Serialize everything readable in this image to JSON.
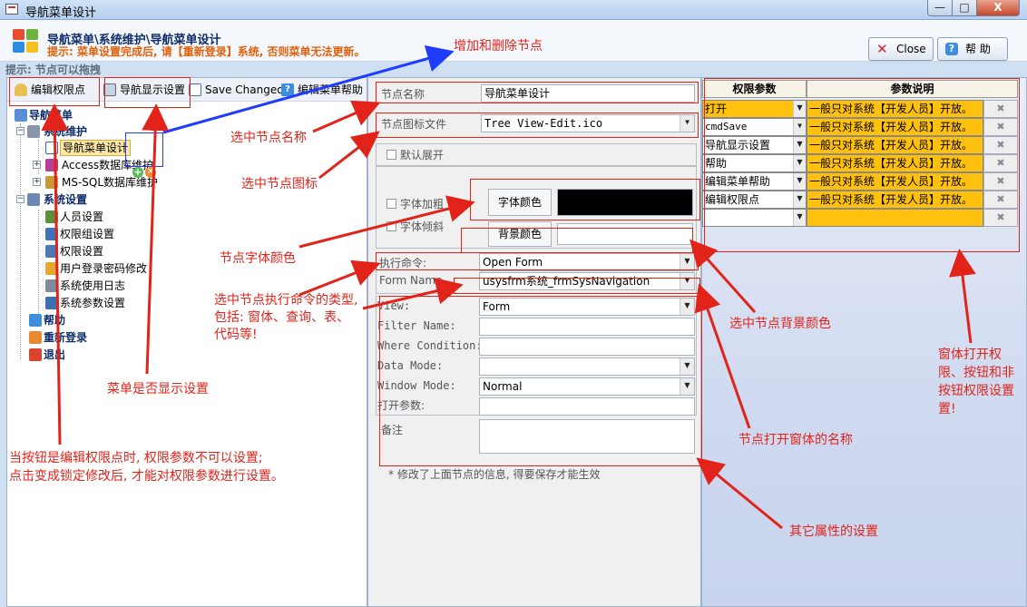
{
  "window": {
    "title": "导航菜单设计",
    "controls": [
      "—",
      "□",
      "X"
    ]
  },
  "header": {
    "breadcrumb": "导航菜单\\系统维护\\导航菜单设计",
    "hint": "提示: 菜单设置完成后, 请【重新登录】系统, 否则菜单无法更新。",
    "close_label": "Close",
    "help_label": "帮  助"
  },
  "subhint": "提示: 节点可以拖拽",
  "toolbar": {
    "edit_perm": "编辑权限点",
    "nav_display": "导航显示设置",
    "save_changed": "Save Changed",
    "edit_help": "编辑菜单帮助"
  },
  "tree": {
    "root": "导航菜单",
    "sys_maint": "系统维护",
    "nav_design": "导航菜单设计",
    "access_maint": "Access数据库维护",
    "mssql_maint": "MS-SQL数据库维护",
    "sys_settings": "系统设置",
    "user_settings": "人员设置",
    "perm_group": "权限组设置",
    "perm_settings": "权限设置",
    "login_pwd": "用户登录密码修改",
    "usage_log": "系统使用日志",
    "sys_params": "系统参数设置",
    "help": "帮助",
    "relogin": "重新登录",
    "exit": "退出"
  },
  "form": {
    "node_name_label": "节点名称",
    "node_name_value": "导航菜单设计",
    "icon_label": "节点图标文件",
    "icon_value": "Tree View-Edit.ico",
    "default_expand": "默认展开",
    "font_bold": "字体加粗",
    "font_italic": "字体倾斜",
    "font_color_btn": "字体颜色",
    "font_color_value": "#000000",
    "bg_color_btn": "背景颜色",
    "bg_color_value": "#ffffff",
    "exec_cmd_label": "执行命令:",
    "exec_cmd_value": "Open Form",
    "form_name_label": "Form Name",
    "form_name_value": "usysfrm系统_frmSysNavigation",
    "view_label": "View:",
    "view_value": "Form",
    "filter_label": "Filter Name:",
    "where_label": "Where Condition:",
    "data_mode_label": "Data Mode:",
    "window_mode_label": "Window Mode:",
    "window_mode_value": "Normal",
    "open_args_label": "打开参数:",
    "notes_label": "备注",
    "footnote": "* 修改了上面节点的信息, 得要保存才能生效"
  },
  "permissions": {
    "col_param": "权限参数",
    "col_desc": "参数说明",
    "rows": [
      {
        "param": "打开",
        "desc": "一般只对系统【开发人员】开放。"
      },
      {
        "param": "cmdSave",
        "desc": "一般只对系统【开发人员】开放。"
      },
      {
        "param": "导航显示设置",
        "desc": "一般只对系统【开发人员】开放。"
      },
      {
        "param": "帮助",
        "desc": "一般只对系统【开发人员】开放。"
      },
      {
        "param": "编辑菜单帮助",
        "desc": "一般只对系统【开发人员】开放。"
      },
      {
        "param": "编辑权限点",
        "desc": "一般只对系统【开发人员】开放。"
      },
      {
        "param": "",
        "desc": ""
      }
    ]
  },
  "annotations": {
    "add_del": "增加和删除节点",
    "sel_name": "选中节点名称",
    "sel_icon": "选中节点图标",
    "font_color": "节点字体颜色",
    "exec_type_1": "选中节点执行命令的类型,",
    "exec_type_2": "包括: 窗体、查询、表、",
    "exec_type_3": "代码等!",
    "menu_show": "菜单是否显示设置",
    "lock_1": "当按钮是编辑权限点时, 权限参数不可以设置;",
    "lock_2": "点击变成锁定修改后, 才能对权限参数进行设置。",
    "bg_color": "选中节点背景颜色",
    "form_name": "节点打开窗体的名称",
    "other_props": "其它属性的设置",
    "perm_1": "窗体打开权",
    "perm_2": "限、按钮和非",
    "perm_3": "按钮权限设置",
    "perm_4": "置!"
  },
  "colors": {
    "annotation": "#e2231a",
    "arrow_blue": "#1f3cff",
    "param_highlight": "#ffc10e"
  }
}
